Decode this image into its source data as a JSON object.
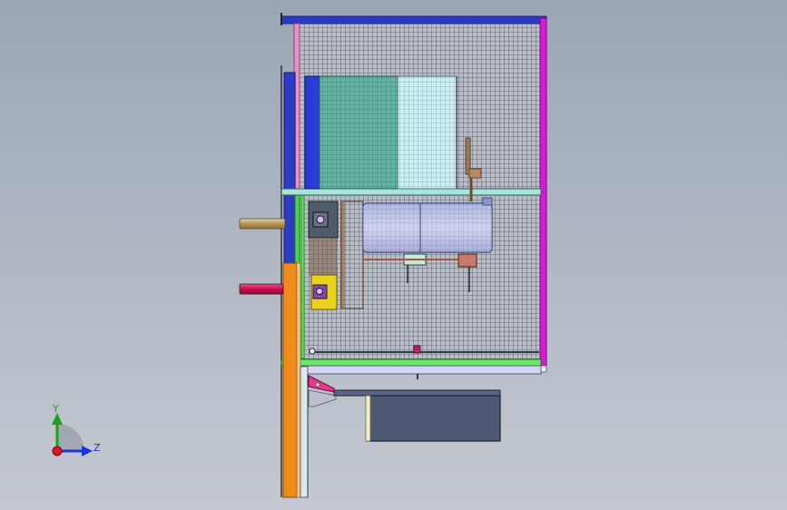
{
  "viewport": {
    "background_top": "#9aa6b6",
    "background_bottom": "#c4c9d0"
  },
  "triad": {
    "y_label": "Y",
    "z_label": "Z",
    "y_color": "#1aa31a",
    "z_color": "#1a36d8",
    "x_color": "#d81a1a"
  },
  "colors": {
    "frame_blue": "#2b3bc4",
    "frame_magenta": "#d81ad8",
    "frame_pink": "#e890c8",
    "frame_green": "#4cd64c",
    "frame_orange": "#f08c1a",
    "mesh": "#5b5b68",
    "mesh_bg": "#b7bcc4",
    "teal_panel": "#5fae9e",
    "cyan_panel": "#bfe6ec",
    "motor": "#8c96cc",
    "yellow_block": "#e8d21a",
    "dark_box": "#4f5872",
    "pipe_tan": "#c8a878",
    "pipe_red": "#d8145a"
  }
}
